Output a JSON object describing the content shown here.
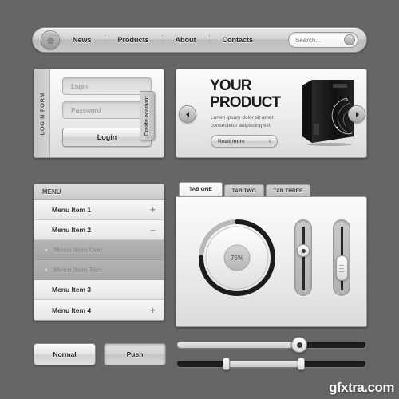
{
  "navbar": {
    "home_icon": "home-icon",
    "links": [
      "News",
      "Products",
      "About",
      "Contacts"
    ],
    "search": {
      "placeholder": "Search...",
      "value": "",
      "button_icon": "search-icon"
    }
  },
  "login_form": {
    "side_label": "LOGIN FORM",
    "username_placeholder": "Login",
    "password_placeholder": "Password",
    "submit_label": "Login",
    "create_account_label": "Create account"
  },
  "banner": {
    "title_line1": "YOUR",
    "title_line2": "PRODUCT",
    "description": "Lorem ipsum dolor sit amet consectetur adipiscing elit!",
    "cta_label": "Read more",
    "cta_arrow": "›",
    "prev_icon": "chevron-left-icon",
    "next_icon": "chevron-right-icon",
    "product_image_alt": "product-box-3d"
  },
  "menu": {
    "header": "MENU",
    "items": [
      {
        "label": "Menu Item 1",
        "toggle": "+",
        "type": "item"
      },
      {
        "label": "Menu Item 2",
        "toggle": "–",
        "type": "item"
      },
      {
        "label": "Menu Item One",
        "toggle": "",
        "type": "sub"
      },
      {
        "label": "Menu Item Two",
        "toggle": "",
        "type": "sub"
      },
      {
        "label": "Menu Item 3",
        "toggle": "",
        "type": "item"
      },
      {
        "label": "Menu Item 4",
        "toggle": "+",
        "type": "item"
      }
    ],
    "sub_chevron": "›"
  },
  "tabs": {
    "items": [
      "TAB ONE",
      "TAB TWO",
      "TAB THREE"
    ],
    "active_index": 0
  },
  "tab_panel": {
    "knob": {
      "label": "75%",
      "value": 75,
      "max": 100
    },
    "vertical_sliders": [
      {
        "name": "vertical-slider-round",
        "value": 62
      },
      {
        "name": "vertical-slider-pill",
        "value": 40
      }
    ]
  },
  "buttons": {
    "normal_label": "Normal",
    "push_label": "Push"
  },
  "horizontal_sliders": [
    {
      "name": "horizontal-slider-single",
      "value": 65
    },
    {
      "name": "horizontal-slider-range",
      "low": 26,
      "high": 66
    }
  ],
  "watermark": "gfxtra.com",
  "colors": {
    "page_background": "#666666",
    "panel_light": "#fbfbfb",
    "panel_dark": "#dcdcdc",
    "track_dark": "#1e1e1e",
    "text_primary": "#2e2e2e",
    "text_muted": "#8d8d8d"
  }
}
